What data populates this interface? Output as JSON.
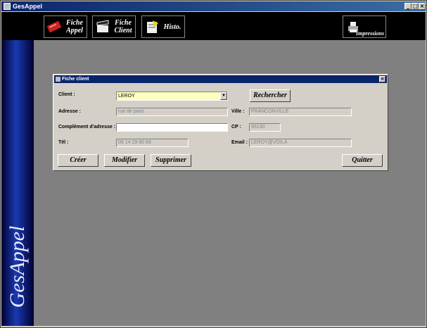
{
  "window": {
    "title": "GesAppel",
    "minimize": "_",
    "maximize": "□",
    "close": "×"
  },
  "toolbar": {
    "fiche_appel": {
      "line1": "Fiche",
      "line2": "Appel",
      "icon": "ticket-icon"
    },
    "fiche_client": {
      "line1": "Fiche",
      "line2": "Client",
      "icon": "clapperboard-icon"
    },
    "histo": {
      "label": "Histo.",
      "icon": "history-notes-icon"
    },
    "impressions": {
      "label": "Impressions",
      "icon": "printer-icon"
    }
  },
  "sidebar": {
    "brand": "GesAppel",
    "colors": {
      "gradient_mid": "#1a3ab0",
      "gradient_edge": "#000033"
    }
  },
  "dialog": {
    "title": "Fiche client",
    "close": "×",
    "labels": {
      "client": "Client :",
      "adresse": "Adresse :",
      "complement": "Complément d'adresse :",
      "tel": "Tél :",
      "ville": "Ville :",
      "cp": "CP :",
      "email": "Email :"
    },
    "fields": {
      "client": "LEROY",
      "adresse": "rue de paris",
      "complement": "",
      "tel": "06 14 29 80 69",
      "ville": "FRANCONVILLE",
      "cp": "95130",
      "email": "LEROY@VOILÀ"
    },
    "buttons": {
      "rechercher": "Rechercher",
      "creer": "Créer",
      "modifier": "Modifier",
      "supprimer": "Supprimer",
      "quitter": "Quitter"
    }
  },
  "colors": {
    "workspace": "#808080",
    "combo_background": "#ffffc0",
    "titlebar": "#0a246a"
  }
}
